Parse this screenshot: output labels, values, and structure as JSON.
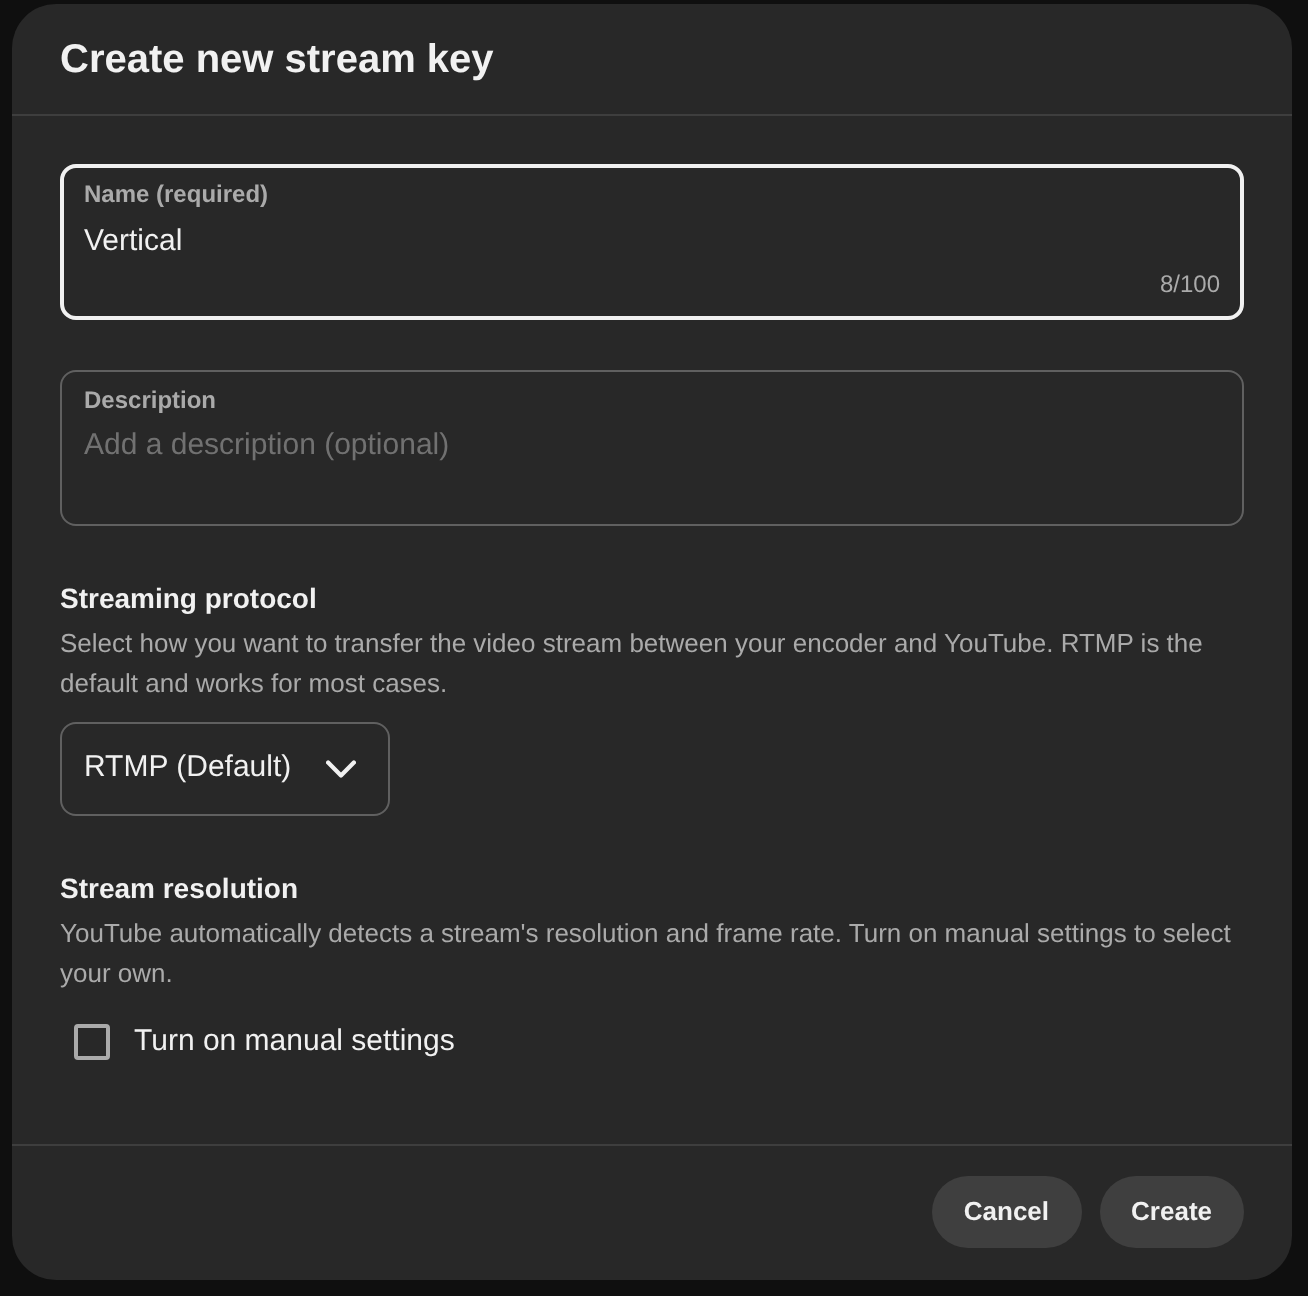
{
  "dialog": {
    "title": "Create new stream key",
    "name_field": {
      "label": "Name (required)",
      "value": "Vertical",
      "counter": "8/100",
      "focused": true
    },
    "description_field": {
      "label": "Description",
      "placeholder": "Add a description (optional)",
      "focused": false
    },
    "sections": [
      {
        "kind": "dropdown",
        "heading": "Streaming protocol",
        "text": "Select how you want to transfer the video stream between your encoder and YouTube. RTMP is the default and works for most cases.",
        "dropdown": {
          "value": "RTMP (Default)"
        }
      },
      {
        "kind": "checkbox",
        "heading": "Stream resolution",
        "text": "YouTube automatically detects a stream's resolution and frame rate. Turn on manual settings to select your own.",
        "checkbox": {
          "label": "Turn on manual settings",
          "checked": false
        }
      }
    ],
    "buttons": [
      {
        "label": "Cancel"
      },
      {
        "label": "Create"
      }
    ]
  }
}
